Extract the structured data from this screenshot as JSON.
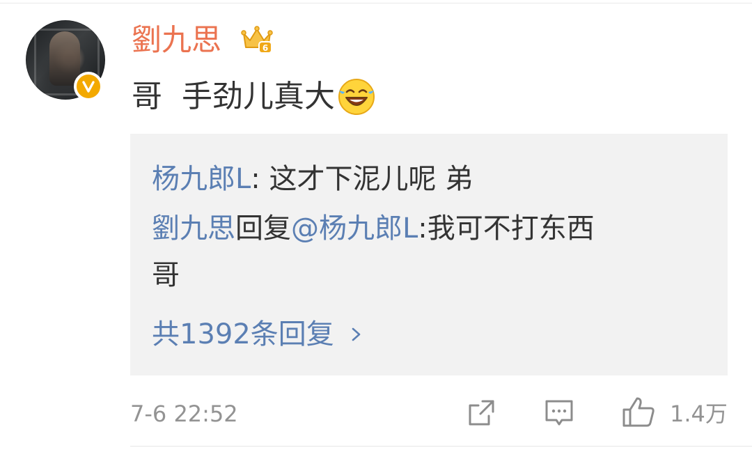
{
  "comment": {
    "author": "劉九思",
    "author_level": "6",
    "text": "哥  手劲儿真大",
    "emoji": "laugh-cry-emoji",
    "time": "7-6 22:52",
    "like_count": "1.4万"
  },
  "replies": [
    {
      "author": "杨九郎L",
      "separator": ": ",
      "text": "这才下泥儿呢 弟"
    },
    {
      "author": "劉九思",
      "reply_word": "回复",
      "mention": "@杨九郎L",
      "separator": ":",
      "text_line1": "我可不打东西",
      "text_line2": "哥"
    }
  ],
  "reply_summary": "共1392条回复",
  "colors": {
    "username": "#eb7350",
    "link": "#5b7fb3",
    "text": "#333333",
    "meta": "#939393",
    "reply_bg": "#f2f2f2",
    "badge": "#f3a900"
  }
}
